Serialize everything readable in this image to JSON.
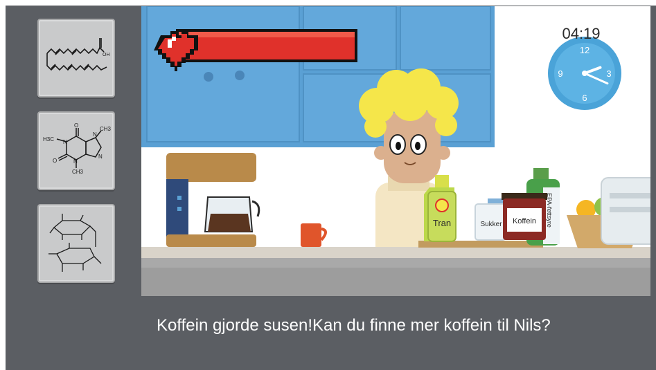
{
  "inventory": {
    "slots": [
      {
        "name": "molecule-fatty-acid",
        "icon": "fatty-acid-structure-icon",
        "atom_label": "OH"
      },
      {
        "name": "molecule-caffeine",
        "icon": "caffeine-structure-icon",
        "labels": [
          "H3C",
          "N",
          "O",
          "CH3",
          "N",
          "O",
          "N",
          "N",
          "CH3"
        ]
      },
      {
        "name": "molecule-sucrose",
        "icon": "sucrose-structure-icon"
      }
    ]
  },
  "hud": {
    "health_fraction": 1.0,
    "clock_time": "04:19",
    "clock_hour": 2,
    "clock_minute": 19,
    "clock_numbers": [
      "12",
      "3",
      "6",
      "9"
    ]
  },
  "scene": {
    "items": {
      "tran_label": "Tran",
      "sukker_label": "Sukker",
      "koffein_label": "Koffein",
      "epa_label": "EPA-fettsyre"
    }
  },
  "dialog": {
    "text": "Koffein gjorde susen!Kan du finne mer koffein til Nils?"
  },
  "colors": {
    "frame": "#5b5e63",
    "health": "#e0312b",
    "cabinet": "#5aa0d4",
    "clock": "#4aa3d8"
  }
}
